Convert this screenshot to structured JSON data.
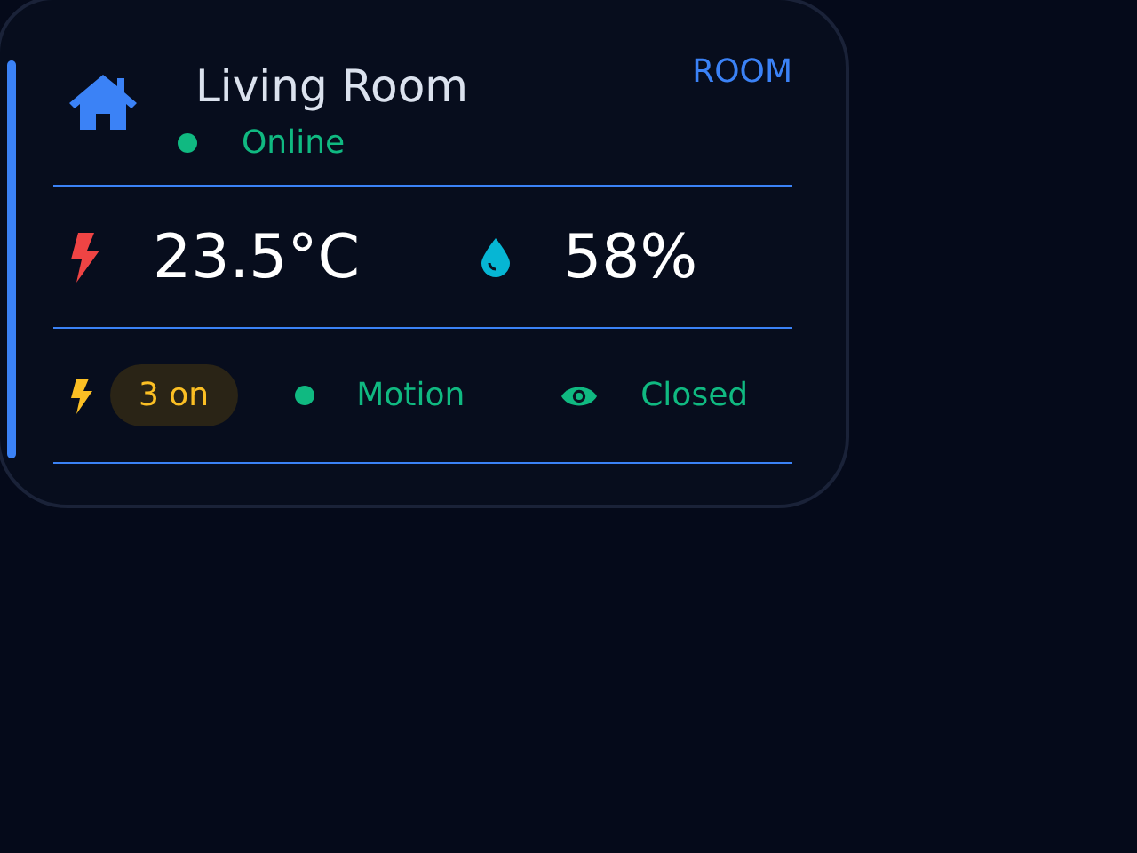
{
  "room": {
    "name": "Living Room",
    "status": "Online",
    "badge": "ROOM"
  },
  "climate": {
    "temperature": "23.5°C",
    "humidity": "58%"
  },
  "devices": {
    "lights": "3 on",
    "motion": "Motion",
    "door": "Closed"
  }
}
